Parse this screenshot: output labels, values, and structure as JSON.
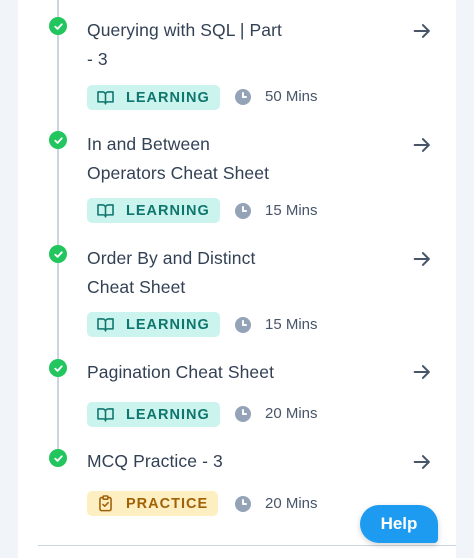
{
  "items": [
    {
      "title_line1": "Querying with SQL | Part",
      "title_line2": "- 3",
      "badge": "LEARNING",
      "duration": "50 Mins"
    },
    {
      "title_line1": "In and Between",
      "title_line2": "Operators Cheat Sheet",
      "badge": "LEARNING",
      "duration": "15 Mins"
    },
    {
      "title_line1": "Order By and Distinct",
      "title_line2": "Cheat Sheet",
      "badge": "LEARNING",
      "duration": "15 Mins"
    },
    {
      "title_line1": "Pagination Cheat Sheet",
      "title_line2": "",
      "badge": "LEARNING",
      "duration": "20 Mins"
    },
    {
      "title_line1": "MCQ Practice - 3",
      "title_line2": "",
      "badge": "PRACTICE",
      "duration": "20 Mins"
    }
  ],
  "help_label": "Help",
  "colors": {
    "completed": "#22c55e",
    "learning_bg": "#ccf4ef",
    "learning_text": "#0f766e",
    "practice_bg": "#fdefc2",
    "practice_text": "#a16207",
    "help_button": "#1d9bf0"
  }
}
